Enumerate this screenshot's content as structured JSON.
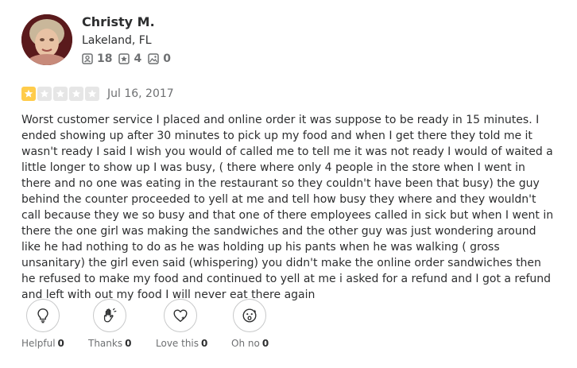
{
  "user": {
    "name": "Christy M.",
    "location": "Lakeland, FL",
    "stats": {
      "friends": "18",
      "reviews": "4",
      "photos": "0"
    }
  },
  "review": {
    "rating": 1,
    "max_rating": 5,
    "date": "Jul 16, 2017",
    "text": "Worst customer service I placed and online order it was suppose to be ready in 15 minutes. I ended showing up after 30 minutes to pick up my food and when I get there they told me it wasn't ready I said I wish you would of called me to tell me it was not ready I would of waited a little longer to show up I was busy, ( there where only 4 people in the store when I went in there and no one was eating in the restaurant so they couldn't have been that busy) the guy behind the counter proceeded to yell at me and tell how busy they where and they wouldn't call because they we so busy and that one of there employees called in sick but when I went in there the one girl was making the sandwiches and the other guy was just wondering around like he had nothing to do as he was holding up his pants when he was walking ( gross unsanitary) the girl even said (whispering) you didn't make the online order sandwiches then he refused to make my food and continued to yell at me i asked for a refund and I got a refund and left with out my food I will never eat there again"
  },
  "reactions": [
    {
      "label": "Helpful",
      "count": "0",
      "icon": "lightbulb-icon"
    },
    {
      "label": "Thanks",
      "count": "0",
      "icon": "wave-hand-icon"
    },
    {
      "label": "Love this",
      "count": "0",
      "icon": "heart-icon"
    },
    {
      "label": "Oh no",
      "count": "0",
      "icon": "oh-no-face-icon"
    }
  ],
  "colors": {
    "star_active": "#ffcc4b",
    "star_inactive": "#e6e6e6",
    "text_primary": "#2d2e2f",
    "text_secondary": "#6e7072"
  }
}
